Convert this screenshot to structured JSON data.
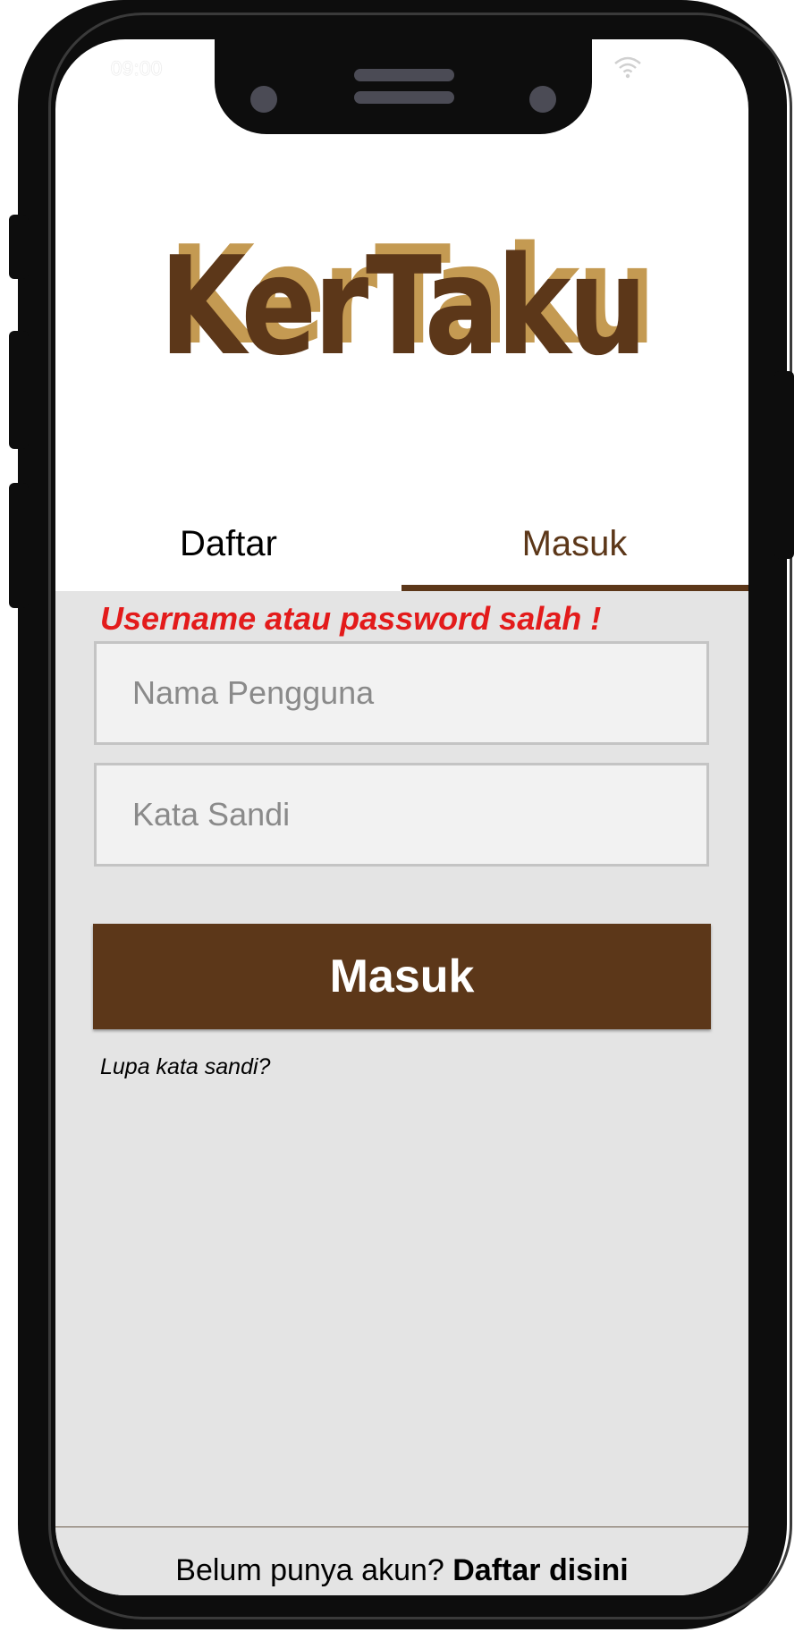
{
  "status_bar": {
    "time": "09:00",
    "wifi_icon": "wifi-icon"
  },
  "logo": {
    "text": "KerTaku",
    "color_main": "#5c3719",
    "color_shadow": "#c49a52"
  },
  "tabs": [
    {
      "label": "Daftar",
      "active": false
    },
    {
      "label": "Masuk",
      "active": true
    }
  ],
  "form": {
    "error_message": "Username atau password salah !",
    "username_placeholder": "Nama Pengguna",
    "password_placeholder": "Kata Sandi",
    "submit_label": "Masuk",
    "forgot_password": "Lupa kata sandi?"
  },
  "footer": {
    "prompt": "Belum punya akun?",
    "link": "Daftar disini"
  },
  "colors": {
    "brand_brown": "#5c3719",
    "error_red": "#e31b1b",
    "panel_gray": "#e4e4e4"
  }
}
